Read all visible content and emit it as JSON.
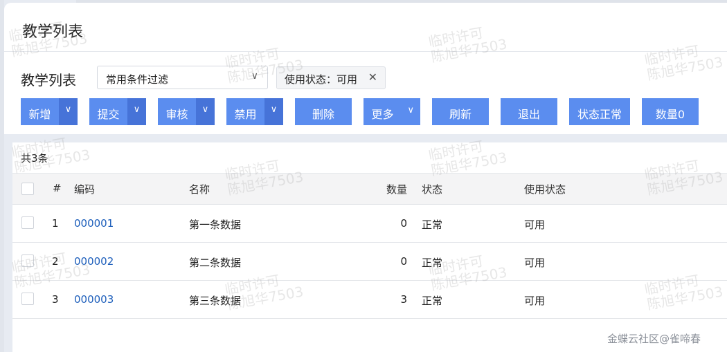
{
  "page": {
    "title": "教学列表"
  },
  "filter": {
    "label": "教学列表",
    "select_value": "常用条件过滤",
    "tag": "使用状态：可用"
  },
  "toolbar": {
    "add": "新增",
    "submit": "提交",
    "audit": "审核",
    "disable": "禁用",
    "delete": "删除",
    "more": "更多",
    "refresh": "刷新",
    "exit": "退出",
    "status_normal": "状态正常",
    "quantity": "数量0"
  },
  "list": {
    "count": "共3条",
    "headers": {
      "index": "#",
      "code": "编码",
      "name": "名称",
      "qty": "数量",
      "status": "状态",
      "use_status": "使用状态"
    },
    "rows": [
      {
        "index": "1",
        "code": "000001",
        "name": "第一条数据",
        "qty": "0",
        "status": "正常",
        "use_status": "可用"
      },
      {
        "index": "2",
        "code": "000002",
        "name": "第二条数据",
        "qty": "0",
        "status": "正常",
        "use_status": "可用"
      },
      {
        "index": "3",
        "code": "000003",
        "name": "第三条数据",
        "qty": "3",
        "status": "正常",
        "use_status": "可用"
      }
    ]
  },
  "watermark": {
    "line1": "临时许可",
    "line2": "陈旭华7503"
  },
  "footer": {
    "mark": "金蝶云社区@雀啼春"
  },
  "colors": {
    "primary_button": "#5b8def",
    "split_arrow": "#4673d8",
    "link": "#1e5fbb"
  },
  "icons": {
    "select_chevron": "chevron-down-icon",
    "tag_close": "close-icon",
    "button_dropdown": "caret-down-icon"
  }
}
